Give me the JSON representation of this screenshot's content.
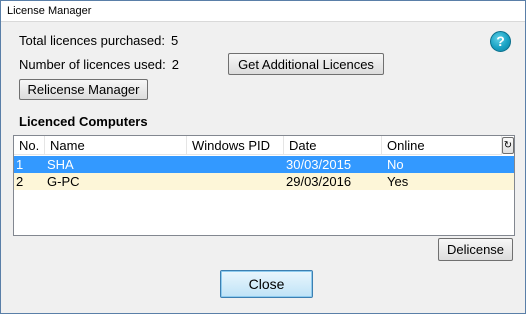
{
  "window": {
    "title": "License Manager"
  },
  "stats": {
    "purchased_label": "Total licences purchased:",
    "purchased_value": "5",
    "used_label": "Number of licences used:",
    "used_value": "2"
  },
  "buttons": {
    "get_additional": "Get Additional Licences",
    "relicense": "Relicense Manager",
    "delicense": "Delicense",
    "close": "Close",
    "help": "?",
    "refresh_icon": "refresh-icon"
  },
  "table": {
    "title": "Licenced Computers",
    "columns": [
      "No.",
      "Name",
      "Windows PID",
      "Date",
      "Online"
    ],
    "rows": [
      {
        "no": "1",
        "name": "SHA",
        "pid": "",
        "date": "30/03/2015",
        "online": "No",
        "selected": true
      },
      {
        "no": "2",
        "name": "G-PC",
        "pid": "",
        "date": "29/03/2016",
        "online": "Yes",
        "selected": false
      }
    ]
  },
  "colors": {
    "selection": "#3399ff",
    "alt_row": "#fdf6d8",
    "help_icon": "#1aa2c4"
  }
}
